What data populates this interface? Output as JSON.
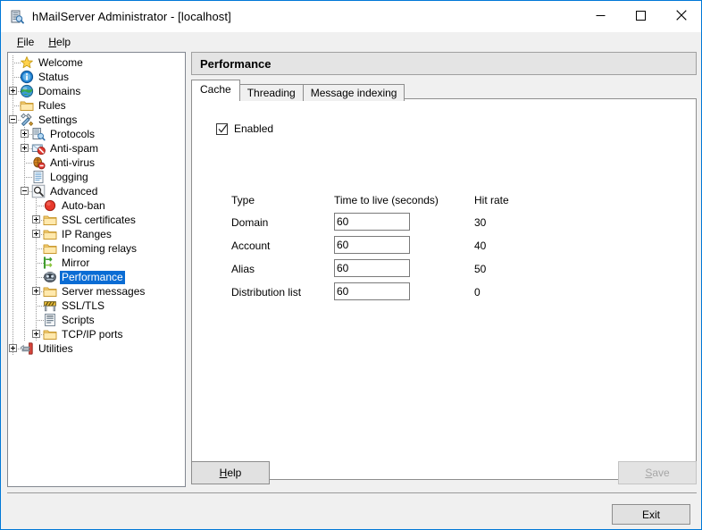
{
  "window": {
    "title": "hMailServer Administrator - [localhost]",
    "app_icon": "server-icon",
    "minimize_label": "Minimize",
    "maximize_label": "Maximize",
    "close_label": "Close",
    "accent_color": "#0078d7"
  },
  "menubar": {
    "items": [
      {
        "label": "File",
        "mnemonic": "F"
      },
      {
        "label": "Help",
        "mnemonic": "H"
      }
    ]
  },
  "tree": {
    "nodes": [
      {
        "label": "Welcome",
        "icon": "star-icon",
        "depth": 1,
        "expander": "none",
        "selected": false
      },
      {
        "label": "Status",
        "icon": "info-icon",
        "depth": 1,
        "expander": "none",
        "selected": false
      },
      {
        "label": "Domains",
        "icon": "globe-icon",
        "depth": 1,
        "expander": "plus",
        "selected": false
      },
      {
        "label": "Rules",
        "icon": "folder-icon",
        "depth": 1,
        "expander": "none",
        "selected": false
      },
      {
        "label": "Settings",
        "icon": "tools-icon",
        "depth": 1,
        "expander": "minus",
        "selected": false
      },
      {
        "label": "Protocols",
        "icon": "protocols-icon",
        "depth": 2,
        "expander": "plus",
        "selected": false
      },
      {
        "label": "Anti-spam",
        "icon": "antispam-icon",
        "depth": 2,
        "expander": "plus",
        "selected": false
      },
      {
        "label": "Anti-virus",
        "icon": "antivirus-icon",
        "depth": 2,
        "expander": "none",
        "selected": false
      },
      {
        "label": "Logging",
        "icon": "log-icon",
        "depth": 2,
        "expander": "none",
        "selected": false
      },
      {
        "label": "Advanced",
        "icon": "magnifier-icon",
        "depth": 2,
        "expander": "minus",
        "selected": false
      },
      {
        "label": "Auto-ban",
        "icon": "ban-icon",
        "depth": 3,
        "expander": "none",
        "selected": false
      },
      {
        "label": "SSL certificates",
        "icon": "folder-icon",
        "depth": 3,
        "expander": "plus",
        "selected": false
      },
      {
        "label": "IP Ranges",
        "icon": "folder-icon",
        "depth": 3,
        "expander": "plus",
        "selected": false
      },
      {
        "label": "Incoming relays",
        "icon": "folder-icon",
        "depth": 3,
        "expander": "none",
        "selected": false
      },
      {
        "label": "Mirror",
        "icon": "mirror-icon",
        "depth": 3,
        "expander": "none",
        "selected": false
      },
      {
        "label": "Performance",
        "icon": "performance-icon",
        "depth": 3,
        "expander": "none",
        "selected": true
      },
      {
        "label": "Server messages",
        "icon": "folder-icon",
        "depth": 3,
        "expander": "plus",
        "selected": false
      },
      {
        "label": "SSL/TLS",
        "icon": "barrier-icon",
        "depth": 3,
        "expander": "none",
        "selected": false
      },
      {
        "label": "Scripts",
        "icon": "script-icon",
        "depth": 3,
        "expander": "none",
        "selected": false
      },
      {
        "label": "TCP/IP ports",
        "icon": "folder-icon",
        "depth": 3,
        "expander": "plus",
        "selected": false
      },
      {
        "label": "Utilities",
        "icon": "utilities-icon",
        "depth": 1,
        "expander": "plus",
        "selected": false
      }
    ],
    "selection_color": "#0a6cd4"
  },
  "header": {
    "title": "Performance"
  },
  "tabs": [
    {
      "label": "Cache",
      "active": true
    },
    {
      "label": "Threading",
      "active": false
    },
    {
      "label": "Message indexing",
      "active": false
    }
  ],
  "cache": {
    "enabled": {
      "label": "Enabled",
      "checked": true
    },
    "columns": {
      "type": "Type",
      "ttl": "Time to live (seconds)",
      "hit_rate": "Hit rate"
    },
    "rows": [
      {
        "type": "Domain",
        "ttl": "60",
        "hit_rate": "30"
      },
      {
        "type": "Account",
        "ttl": "60",
        "hit_rate": "40"
      },
      {
        "type": "Alias",
        "ttl": "60",
        "hit_rate": "50"
      },
      {
        "type": "Distribution list",
        "ttl": "60",
        "hit_rate": "0"
      }
    ]
  },
  "buttons": {
    "help": {
      "label": "Help",
      "mnemonic": "H",
      "enabled": true
    },
    "save": {
      "label": "Save",
      "mnemonic": "S",
      "enabled": false
    },
    "exit": {
      "label": "Exit",
      "enabled": true
    }
  }
}
